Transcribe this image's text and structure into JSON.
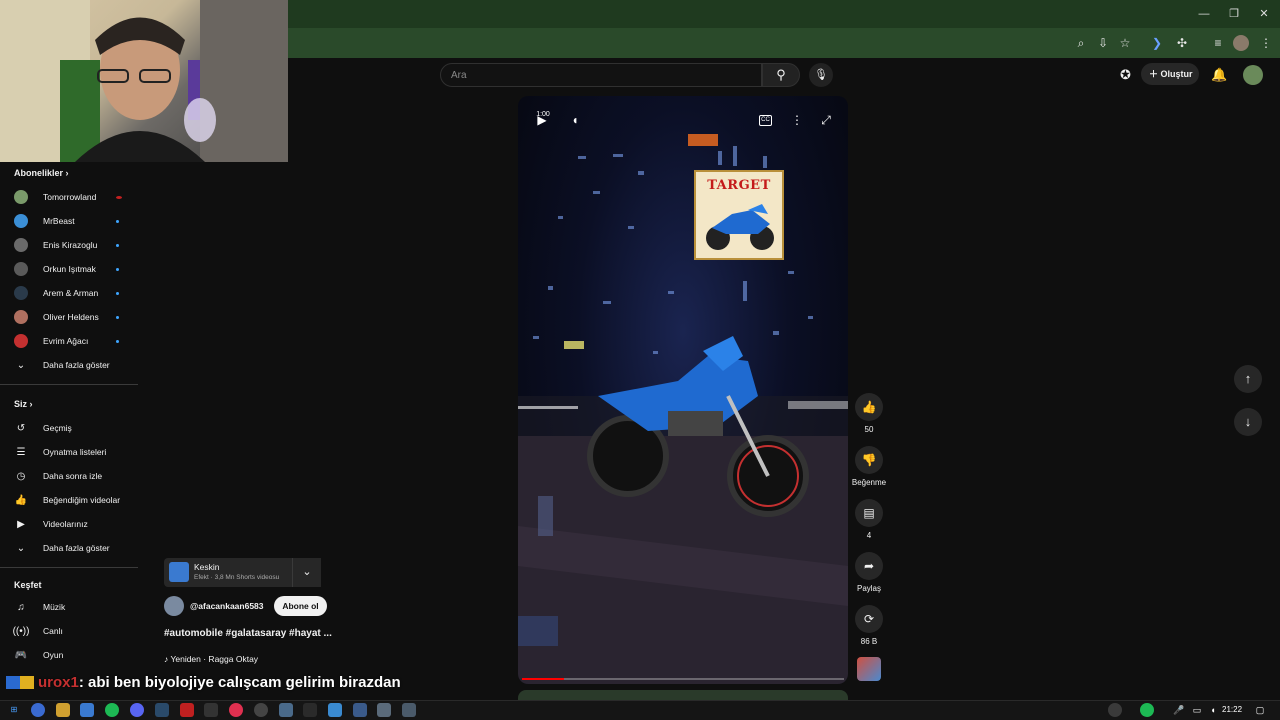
{
  "browser": {
    "window_controls": [
      "—",
      "❐",
      "✕"
    ],
    "toolbar_icons": [
      "zoom-icon",
      "install-icon",
      "star-icon",
      "extension-icon",
      "puzzle-icon",
      "media-icon",
      "profile-icon",
      "menu-icon"
    ]
  },
  "header": {
    "search_placeholder": "Ara",
    "create_label": "Oluştur"
  },
  "sidebar": {
    "subscriptions_title": "Abonelikler",
    "subscriptions": [
      {
        "label": "Tomorrowland",
        "color": "#7a9a6a"
      },
      {
        "label": "MrBeast",
        "color": "#3b8fd6"
      },
      {
        "label": "Enis Kirazoglu",
        "color": "#6a6a6a"
      },
      {
        "label": "Orkun Işıtmak",
        "color": "#5a5a5a"
      },
      {
        "label": "Arem & Arman",
        "color": "#2a3a4a"
      },
      {
        "label": "Oliver Heldens",
        "color": "#b07060"
      },
      {
        "label": "Evrim Ağacı",
        "color": "#c43030"
      }
    ],
    "show_more": "Daha fazla göster",
    "you_title": "Siz",
    "you_items": [
      {
        "label": "Geçmiş",
        "icon": "↺"
      },
      {
        "label": "Oynatma listeleri",
        "icon": "☰"
      },
      {
        "label": "Daha sonra izle",
        "icon": "◷"
      },
      {
        "label": "Beğendiğim videolar",
        "icon": "👍"
      },
      {
        "label": "Videolarınız",
        "icon": "▶"
      }
    ],
    "show_more_2": "Daha fazla göster",
    "explore_title": "Keşfet",
    "explore_items": [
      {
        "label": "Müzik",
        "icon": "♫"
      },
      {
        "label": "Canlı",
        "icon": "((•))"
      },
      {
        "label": "Oyun",
        "icon": "🎮"
      }
    ]
  },
  "video": {
    "time": "1:00",
    "sticker_text": "TARGET",
    "progress": 0.13
  },
  "actions": {
    "likes": "50",
    "dislike_label": "Beğenme",
    "comments": "4",
    "share_label": "Paylaş",
    "remix_count": "86 B"
  },
  "info": {
    "effect_title": "Keskin",
    "effect_sub": "Efekt · 3,8 Mn Shorts videosu",
    "channel": "@afacankaan6583",
    "subscribe_label": "Abone ol",
    "title": "#automobile #galatasaray #hayat ...",
    "music": "Yeniden · Ragga Oktay"
  },
  "overlay": {
    "chat_user": "urox1",
    "chat_message": ": abi ben biyolojiye calışcam gelirim birazdan"
  },
  "taskbar": {
    "time": "21:22"
  }
}
